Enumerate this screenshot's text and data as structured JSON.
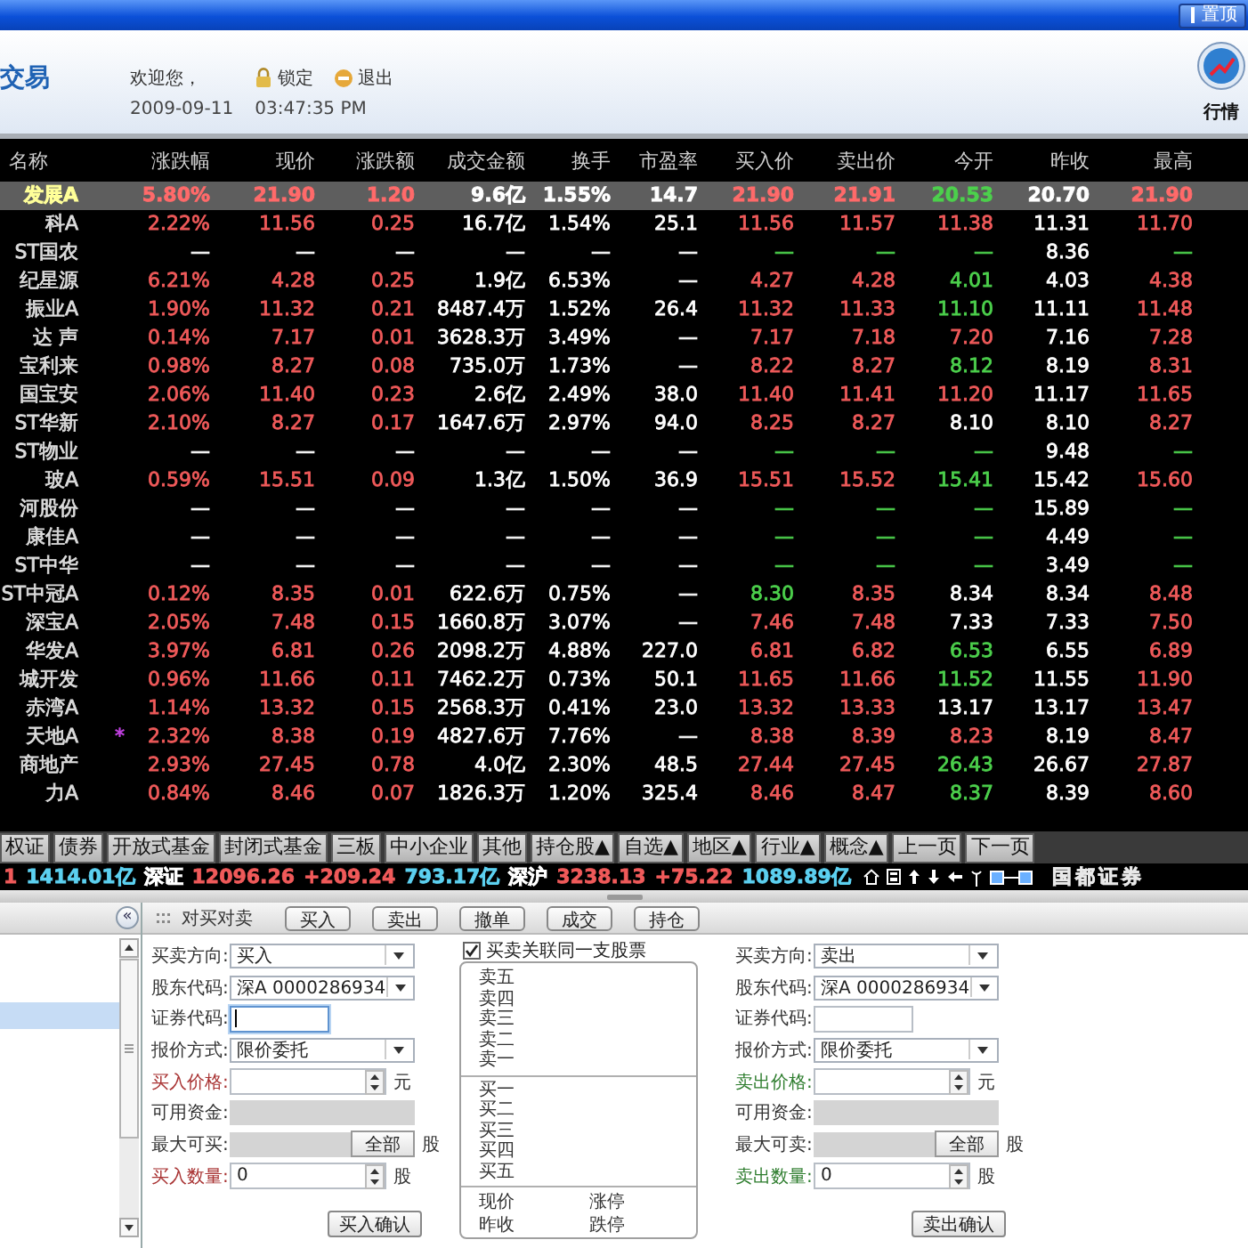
{
  "title_bar": {
    "pin_button": "置顶"
  },
  "header": {
    "logo": "交易",
    "welcome": "欢迎您，",
    "actions": [
      {
        "kind": "lock",
        "label": "锁定"
      },
      {
        "kind": "exit",
        "label": "退出"
      }
    ],
    "date": "2009-09-11",
    "time": "03:47:35 PM",
    "quote_button": "行情"
  },
  "table": {
    "name_column": "名称",
    "columns": [
      "涨跌幅",
      "现价",
      "涨跌额",
      "成交金额",
      "换手",
      "市盈率",
      "买入价",
      "卖出价",
      "今开",
      "昨收",
      "最高"
    ],
    "rows": [
      {
        "name": "发展A",
        "selected": true,
        "cells": [
          {
            "text": "5.80%",
            "color": "#ff6a6a"
          },
          {
            "text": "21.90",
            "color": "#ff6a6a"
          },
          {
            "text": "1.20",
            "color": "#ff6a6a"
          },
          {
            "text": "9.6亿",
            "color": "#ffffff"
          },
          {
            "text": "1.55%",
            "color": "#ffffff"
          },
          {
            "text": "14.7",
            "color": "#ffffff"
          },
          {
            "text": "21.90",
            "color": "#ff6a6a"
          },
          {
            "text": "21.91",
            "color": "#ff6a6a"
          },
          {
            "text": "20.53",
            "color": "#4cd04c"
          },
          {
            "text": "20.70",
            "color": "#ffffff"
          },
          {
            "text": "21.90",
            "color": "#ff6a6a"
          }
        ]
      },
      {
        "name": "科A",
        "selected": false,
        "cells": [
          {
            "text": "2.22%",
            "color": "#f05a5a"
          },
          {
            "text": "11.56",
            "color": "#f05a5a"
          },
          {
            "text": "0.25",
            "color": "#f05a5a"
          },
          {
            "text": "16.7亿",
            "color": "#ffffff"
          },
          {
            "text": "1.54%",
            "color": "#ffffff"
          },
          {
            "text": "25.1",
            "color": "#ffffff"
          },
          {
            "text": "11.56",
            "color": "#f05a5a"
          },
          {
            "text": "11.57",
            "color": "#f05a5a"
          },
          {
            "text": "11.38",
            "color": "#f05a5a"
          },
          {
            "text": "11.31",
            "color": "#ffffff"
          },
          {
            "text": "11.70",
            "color": "#f05a5a"
          }
        ]
      },
      {
        "name": "ST国农",
        "selected": false,
        "cells": [
          {
            "text": "—",
            "color": "#ffffff"
          },
          {
            "text": "—",
            "color": "#ffffff"
          },
          {
            "text": "—",
            "color": "#ffffff"
          },
          {
            "text": "—",
            "color": "#ffffff"
          },
          {
            "text": "—",
            "color": "#ffffff"
          },
          {
            "text": "—",
            "color": "#ffffff"
          },
          {
            "text": "—",
            "color": "#4cd04c"
          },
          {
            "text": "—",
            "color": "#4cd04c"
          },
          {
            "text": "—",
            "color": "#4cd04c"
          },
          {
            "text": "8.36",
            "color": "#ffffff"
          },
          {
            "text": "—",
            "color": "#4cd04c"
          }
        ]
      },
      {
        "name": "纪星源",
        "selected": false,
        "cells": [
          {
            "text": "6.21%",
            "color": "#f05a5a"
          },
          {
            "text": "4.28",
            "color": "#f05a5a"
          },
          {
            "text": "0.25",
            "color": "#f05a5a"
          },
          {
            "text": "1.9亿",
            "color": "#ffffff"
          },
          {
            "text": "6.53%",
            "color": "#ffffff"
          },
          {
            "text": "—",
            "color": "#ffffff"
          },
          {
            "text": "4.27",
            "color": "#f05a5a"
          },
          {
            "text": "4.28",
            "color": "#f05a5a"
          },
          {
            "text": "4.01",
            "color": "#4cd04c"
          },
          {
            "text": "4.03",
            "color": "#ffffff"
          },
          {
            "text": "4.38",
            "color": "#f05a5a"
          }
        ]
      },
      {
        "name": "振业A",
        "selected": false,
        "cells": [
          {
            "text": "1.90%",
            "color": "#f05a5a"
          },
          {
            "text": "11.32",
            "color": "#f05a5a"
          },
          {
            "text": "0.21",
            "color": "#f05a5a"
          },
          {
            "text": "8487.4万",
            "color": "#ffffff"
          },
          {
            "text": "1.52%",
            "color": "#ffffff"
          },
          {
            "text": "26.4",
            "color": "#ffffff"
          },
          {
            "text": "11.32",
            "color": "#f05a5a"
          },
          {
            "text": "11.33",
            "color": "#f05a5a"
          },
          {
            "text": "11.10",
            "color": "#4cd04c"
          },
          {
            "text": "11.11",
            "color": "#ffffff"
          },
          {
            "text": "11.48",
            "color": "#f05a5a"
          }
        ]
      },
      {
        "name": "达 声",
        "selected": false,
        "cells": [
          {
            "text": "0.14%",
            "color": "#f05a5a"
          },
          {
            "text": "7.17",
            "color": "#f05a5a"
          },
          {
            "text": "0.01",
            "color": "#f05a5a"
          },
          {
            "text": "3628.3万",
            "color": "#ffffff"
          },
          {
            "text": "3.49%",
            "color": "#ffffff"
          },
          {
            "text": "—",
            "color": "#ffffff"
          },
          {
            "text": "7.17",
            "color": "#f05a5a"
          },
          {
            "text": "7.18",
            "color": "#f05a5a"
          },
          {
            "text": "7.20",
            "color": "#f05a5a"
          },
          {
            "text": "7.16",
            "color": "#ffffff"
          },
          {
            "text": "7.28",
            "color": "#f05a5a"
          }
        ]
      },
      {
        "name": "宝利来",
        "selected": false,
        "cells": [
          {
            "text": "0.98%",
            "color": "#f05a5a"
          },
          {
            "text": "8.27",
            "color": "#f05a5a"
          },
          {
            "text": "0.08",
            "color": "#f05a5a"
          },
          {
            "text": "735.0万",
            "color": "#ffffff"
          },
          {
            "text": "1.73%",
            "color": "#ffffff"
          },
          {
            "text": "—",
            "color": "#ffffff"
          },
          {
            "text": "8.22",
            "color": "#f05a5a"
          },
          {
            "text": "8.27",
            "color": "#f05a5a"
          },
          {
            "text": "8.12",
            "color": "#4cd04c"
          },
          {
            "text": "8.19",
            "color": "#ffffff"
          },
          {
            "text": "8.31",
            "color": "#f05a5a"
          }
        ]
      },
      {
        "name": "国宝安",
        "selected": false,
        "cells": [
          {
            "text": "2.06%",
            "color": "#f05a5a"
          },
          {
            "text": "11.40",
            "color": "#f05a5a"
          },
          {
            "text": "0.23",
            "color": "#f05a5a"
          },
          {
            "text": "2.6亿",
            "color": "#ffffff"
          },
          {
            "text": "2.49%",
            "color": "#ffffff"
          },
          {
            "text": "38.0",
            "color": "#ffffff"
          },
          {
            "text": "11.40",
            "color": "#f05a5a"
          },
          {
            "text": "11.41",
            "color": "#f05a5a"
          },
          {
            "text": "11.20",
            "color": "#f05a5a"
          },
          {
            "text": "11.17",
            "color": "#ffffff"
          },
          {
            "text": "11.65",
            "color": "#f05a5a"
          }
        ]
      },
      {
        "name": "ST华新",
        "selected": false,
        "cells": [
          {
            "text": "2.10%",
            "color": "#f05a5a"
          },
          {
            "text": "8.27",
            "color": "#f05a5a"
          },
          {
            "text": "0.17",
            "color": "#f05a5a"
          },
          {
            "text": "1647.6万",
            "color": "#ffffff"
          },
          {
            "text": "2.97%",
            "color": "#ffffff"
          },
          {
            "text": "94.0",
            "color": "#ffffff"
          },
          {
            "text": "8.25",
            "color": "#f05a5a"
          },
          {
            "text": "8.27",
            "color": "#f05a5a"
          },
          {
            "text": "8.10",
            "color": "#ffffff"
          },
          {
            "text": "8.10",
            "color": "#ffffff"
          },
          {
            "text": "8.27",
            "color": "#f05a5a"
          }
        ]
      },
      {
        "name": "ST物业",
        "selected": false,
        "cells": [
          {
            "text": "—",
            "color": "#ffffff"
          },
          {
            "text": "—",
            "color": "#ffffff"
          },
          {
            "text": "—",
            "color": "#ffffff"
          },
          {
            "text": "—",
            "color": "#ffffff"
          },
          {
            "text": "—",
            "color": "#ffffff"
          },
          {
            "text": "—",
            "color": "#ffffff"
          },
          {
            "text": "—",
            "color": "#4cd04c"
          },
          {
            "text": "—",
            "color": "#4cd04c"
          },
          {
            "text": "—",
            "color": "#4cd04c"
          },
          {
            "text": "9.48",
            "color": "#ffffff"
          },
          {
            "text": "—",
            "color": "#4cd04c"
          }
        ]
      },
      {
        "name": "玻A",
        "selected": false,
        "cells": [
          {
            "text": "0.59%",
            "color": "#f05a5a"
          },
          {
            "text": "15.51",
            "color": "#f05a5a"
          },
          {
            "text": "0.09",
            "color": "#f05a5a"
          },
          {
            "text": "1.3亿",
            "color": "#ffffff"
          },
          {
            "text": "1.50%",
            "color": "#ffffff"
          },
          {
            "text": "36.9",
            "color": "#ffffff"
          },
          {
            "text": "15.51",
            "color": "#f05a5a"
          },
          {
            "text": "15.52",
            "color": "#f05a5a"
          },
          {
            "text": "15.41",
            "color": "#4cd04c"
          },
          {
            "text": "15.42",
            "color": "#ffffff"
          },
          {
            "text": "15.60",
            "color": "#f05a5a"
          }
        ]
      },
      {
        "name": "河股份",
        "selected": false,
        "cells": [
          {
            "text": "—",
            "color": "#ffffff"
          },
          {
            "text": "—",
            "color": "#ffffff"
          },
          {
            "text": "—",
            "color": "#ffffff"
          },
          {
            "text": "—",
            "color": "#ffffff"
          },
          {
            "text": "—",
            "color": "#ffffff"
          },
          {
            "text": "—",
            "color": "#ffffff"
          },
          {
            "text": "—",
            "color": "#4cd04c"
          },
          {
            "text": "—",
            "color": "#4cd04c"
          },
          {
            "text": "—",
            "color": "#4cd04c"
          },
          {
            "text": "15.89",
            "color": "#ffffff"
          },
          {
            "text": "—",
            "color": "#4cd04c"
          }
        ]
      },
      {
        "name": "康佳A",
        "selected": false,
        "cells": [
          {
            "text": "—",
            "color": "#ffffff"
          },
          {
            "text": "—",
            "color": "#ffffff"
          },
          {
            "text": "—",
            "color": "#ffffff"
          },
          {
            "text": "—",
            "color": "#ffffff"
          },
          {
            "text": "—",
            "color": "#ffffff"
          },
          {
            "text": "—",
            "color": "#ffffff"
          },
          {
            "text": "—",
            "color": "#4cd04c"
          },
          {
            "text": "—",
            "color": "#4cd04c"
          },
          {
            "text": "—",
            "color": "#4cd04c"
          },
          {
            "text": "4.49",
            "color": "#ffffff"
          },
          {
            "text": "—",
            "color": "#4cd04c"
          }
        ]
      },
      {
        "name": "ST中华",
        "selected": false,
        "cells": [
          {
            "text": "—",
            "color": "#ffffff"
          },
          {
            "text": "—",
            "color": "#ffffff"
          },
          {
            "text": "—",
            "color": "#ffffff"
          },
          {
            "text": "—",
            "color": "#ffffff"
          },
          {
            "text": "—",
            "color": "#ffffff"
          },
          {
            "text": "—",
            "color": "#ffffff"
          },
          {
            "text": "—",
            "color": "#4cd04c"
          },
          {
            "text": "—",
            "color": "#4cd04c"
          },
          {
            "text": "—",
            "color": "#4cd04c"
          },
          {
            "text": "3.49",
            "color": "#ffffff"
          },
          {
            "text": "—",
            "color": "#4cd04c"
          }
        ]
      },
      {
        "name": "ST中冠A",
        "selected": false,
        "cells": [
          {
            "text": "0.12%",
            "color": "#f05a5a"
          },
          {
            "text": "8.35",
            "color": "#f05a5a"
          },
          {
            "text": "0.01",
            "color": "#f05a5a"
          },
          {
            "text": "622.6万",
            "color": "#ffffff"
          },
          {
            "text": "0.75%",
            "color": "#ffffff"
          },
          {
            "text": "—",
            "color": "#ffffff"
          },
          {
            "text": "8.30",
            "color": "#4cd04c"
          },
          {
            "text": "8.35",
            "color": "#f05a5a"
          },
          {
            "text": "8.34",
            "color": "#ffffff"
          },
          {
            "text": "8.34",
            "color": "#ffffff"
          },
          {
            "text": "8.48",
            "color": "#f05a5a"
          }
        ]
      },
      {
        "name": "深宝A",
        "selected": false,
        "cells": [
          {
            "text": "2.05%",
            "color": "#f05a5a"
          },
          {
            "text": "7.48",
            "color": "#f05a5a"
          },
          {
            "text": "0.15",
            "color": "#f05a5a"
          },
          {
            "text": "1660.8万",
            "color": "#ffffff"
          },
          {
            "text": "3.07%",
            "color": "#ffffff"
          },
          {
            "text": "—",
            "color": "#ffffff"
          },
          {
            "text": "7.46",
            "color": "#f05a5a"
          },
          {
            "text": "7.48",
            "color": "#f05a5a"
          },
          {
            "text": "7.33",
            "color": "#ffffff"
          },
          {
            "text": "7.33",
            "color": "#ffffff"
          },
          {
            "text": "7.50",
            "color": "#f05a5a"
          }
        ]
      },
      {
        "name": "华发A",
        "selected": false,
        "cells": [
          {
            "text": "3.97%",
            "color": "#f05a5a"
          },
          {
            "text": "6.81",
            "color": "#f05a5a"
          },
          {
            "text": "0.26",
            "color": "#f05a5a"
          },
          {
            "text": "2098.2万",
            "color": "#ffffff"
          },
          {
            "text": "4.88%",
            "color": "#ffffff"
          },
          {
            "text": "227.0",
            "color": "#ffffff"
          },
          {
            "text": "6.81",
            "color": "#f05a5a"
          },
          {
            "text": "6.82",
            "color": "#f05a5a"
          },
          {
            "text": "6.53",
            "color": "#4cd04c"
          },
          {
            "text": "6.55",
            "color": "#ffffff"
          },
          {
            "text": "6.89",
            "color": "#f05a5a"
          }
        ]
      },
      {
        "name": "城开发",
        "selected": false,
        "cells": [
          {
            "text": "0.96%",
            "color": "#f05a5a"
          },
          {
            "text": "11.66",
            "color": "#f05a5a"
          },
          {
            "text": "0.11",
            "color": "#f05a5a"
          },
          {
            "text": "7462.2万",
            "color": "#ffffff"
          },
          {
            "text": "0.73%",
            "color": "#ffffff"
          },
          {
            "text": "50.1",
            "color": "#ffffff"
          },
          {
            "text": "11.65",
            "color": "#f05a5a"
          },
          {
            "text": "11.66",
            "color": "#f05a5a"
          },
          {
            "text": "11.52",
            "color": "#4cd04c"
          },
          {
            "text": "11.55",
            "color": "#ffffff"
          },
          {
            "text": "11.90",
            "color": "#f05a5a"
          }
        ]
      },
      {
        "name": "赤湾A",
        "selected": false,
        "cells": [
          {
            "text": "1.14%",
            "color": "#f05a5a"
          },
          {
            "text": "13.32",
            "color": "#f05a5a"
          },
          {
            "text": "0.15",
            "color": "#f05a5a"
          },
          {
            "text": "2568.3万",
            "color": "#ffffff"
          },
          {
            "text": "0.41%",
            "color": "#ffffff"
          },
          {
            "text": "23.0",
            "color": "#ffffff"
          },
          {
            "text": "13.32",
            "color": "#f05a5a"
          },
          {
            "text": "13.33",
            "color": "#f05a5a"
          },
          {
            "text": "13.17",
            "color": "#ffffff"
          },
          {
            "text": "13.17",
            "color": "#ffffff"
          },
          {
            "text": "13.47",
            "color": "#f05a5a"
          }
        ]
      },
      {
        "name": "天地A",
        "flag": "*",
        "selected": false,
        "cells": [
          {
            "text": "2.32%",
            "color": "#f05a5a"
          },
          {
            "text": "8.38",
            "color": "#f05a5a"
          },
          {
            "text": "0.19",
            "color": "#f05a5a"
          },
          {
            "text": "4827.6万",
            "color": "#ffffff"
          },
          {
            "text": "7.76%",
            "color": "#ffffff"
          },
          {
            "text": "—",
            "color": "#ffffff"
          },
          {
            "text": "8.38",
            "color": "#f05a5a"
          },
          {
            "text": "8.39",
            "color": "#f05a5a"
          },
          {
            "text": "8.23",
            "color": "#f05a5a"
          },
          {
            "text": "8.19",
            "color": "#ffffff"
          },
          {
            "text": "8.47",
            "color": "#f05a5a"
          }
        ]
      },
      {
        "name": "商地产",
        "selected": false,
        "cells": [
          {
            "text": "2.93%",
            "color": "#f05a5a"
          },
          {
            "text": "27.45",
            "color": "#f05a5a"
          },
          {
            "text": "0.78",
            "color": "#f05a5a"
          },
          {
            "text": "4.0亿",
            "color": "#ffffff"
          },
          {
            "text": "2.30%",
            "color": "#ffffff"
          },
          {
            "text": "48.5",
            "color": "#ffffff"
          },
          {
            "text": "27.44",
            "color": "#f05a5a"
          },
          {
            "text": "27.45",
            "color": "#f05a5a"
          },
          {
            "text": "26.43",
            "color": "#4cd04c"
          },
          {
            "text": "26.67",
            "color": "#ffffff"
          },
          {
            "text": "27.87",
            "color": "#f05a5a"
          }
        ]
      },
      {
        "name": "力A",
        "selected": false,
        "cells": [
          {
            "text": "0.84%",
            "color": "#f05a5a"
          },
          {
            "text": "8.46",
            "color": "#f05a5a"
          },
          {
            "text": "0.07",
            "color": "#f05a5a"
          },
          {
            "text": "1826.3万",
            "color": "#ffffff"
          },
          {
            "text": "1.20%",
            "color": "#ffffff"
          },
          {
            "text": "325.4",
            "color": "#ffffff"
          },
          {
            "text": "8.46",
            "color": "#f05a5a"
          },
          {
            "text": "8.47",
            "color": "#f05a5a"
          },
          {
            "text": "8.37",
            "color": "#4cd04c"
          },
          {
            "text": "8.39",
            "color": "#ffffff"
          },
          {
            "text": "8.60",
            "color": "#f05a5a"
          }
        ]
      }
    ]
  },
  "category_tabs": [
    "权证",
    "债券",
    "开放式基金",
    "封闭式基金",
    "三板",
    "中小企业",
    "其他",
    "持仓股▲",
    "自选▲",
    "地区▲",
    "行业▲",
    "概念▲",
    "上一页",
    "下一页"
  ],
  "index_bar": {
    "items": [
      {
        "text": "1",
        "color": "#f05a5a"
      },
      {
        "text": "1414.01亿",
        "color": "#5cd0f0"
      },
      {
        "text": "深证",
        "color": "#ffffff"
      },
      {
        "text": "12096.26",
        "color": "#f05a5a"
      },
      {
        "text": "+209.24",
        "color": "#f05a5a"
      },
      {
        "text": "793.17亿",
        "color": "#5cd0f0"
      },
      {
        "text": "深沪",
        "color": "#ffffff"
      },
      {
        "text": "3238.13",
        "color": "#f05a5a"
      },
      {
        "text": "+75.22",
        "color": "#f05a5a"
      },
      {
        "text": "1089.89亿",
        "color": "#5cd0f0"
      }
    ],
    "broker": "国都证券"
  },
  "nav_panel": {
    "collapse_button": "«",
    "rows": [
      {
        "selected": false
      },
      {
        "selected": false
      },
      {
        "selected": true
      }
    ]
  },
  "trade_toolbar": {
    "title": "对买对卖",
    "buttons": [
      "买入",
      "卖出",
      "撤单",
      "成交",
      "持仓"
    ]
  },
  "buy_form": {
    "fields": [
      {
        "kind": "select",
        "label": "买卖方向:",
        "color": "#333333",
        "value": "买入"
      },
      {
        "kind": "select",
        "label": "股东代码:",
        "color": "#333333",
        "value": "深A 0000286934"
      },
      {
        "kind": "input",
        "label": "证券代码:",
        "color": "#333333",
        "focused": true
      },
      {
        "kind": "select",
        "label": "报价方式:",
        "color": "#333333",
        "value": "限价委托"
      },
      {
        "kind": "spin",
        "label": "买入价格:",
        "color": "#a83232",
        "unit": "元"
      },
      {
        "kind": "readonly",
        "label": "可用资金:",
        "color": "#333333"
      },
      {
        "kind": "max",
        "label": "最大可买:",
        "color": "#333333",
        "button": "全部",
        "unit": "股"
      },
      {
        "kind": "spin",
        "label": "买入数量:",
        "color": "#a83232",
        "value": "0",
        "unit": "股"
      }
    ],
    "confirm": "买入确认"
  },
  "order_book": {
    "link_checkbox": {
      "label": "买卖关联同一支股票",
      "checked": true
    },
    "asks": [
      "卖五",
      "卖四",
      "卖三",
      "卖二",
      "卖一"
    ],
    "bids": [
      "买一",
      "买二",
      "买三",
      "买四",
      "买五"
    ],
    "footer": [
      {
        "left": "现价",
        "right": "涨停"
      },
      {
        "left": "昨收",
        "right": "跌停"
      }
    ]
  },
  "sell_form": {
    "fields": [
      {
        "kind": "select",
        "label": "买卖方向:",
        "color": "#333333",
        "value": "卖出"
      },
      {
        "kind": "select",
        "label": "股东代码:",
        "color": "#333333",
        "value": "深A 0000286934"
      },
      {
        "kind": "input",
        "label": "证券代码:",
        "color": "#333333",
        "focused": false
      },
      {
        "kind": "select",
        "label": "报价方式:",
        "color": "#333333",
        "value": "限价委托"
      },
      {
        "kind": "spin",
        "label": "卖出价格:",
        "color": "#2e7d2e",
        "unit": "元"
      },
      {
        "kind": "readonly",
        "label": "可用资金:",
        "color": "#333333"
      },
      {
        "kind": "max",
        "label": "最大可卖:",
        "color": "#333333",
        "button": "全部",
        "unit": "股"
      },
      {
        "kind": "spin",
        "label": "卖出数量:",
        "color": "#2e7d2e",
        "value": "0",
        "unit": "股"
      }
    ],
    "confirm": "卖出确认"
  }
}
